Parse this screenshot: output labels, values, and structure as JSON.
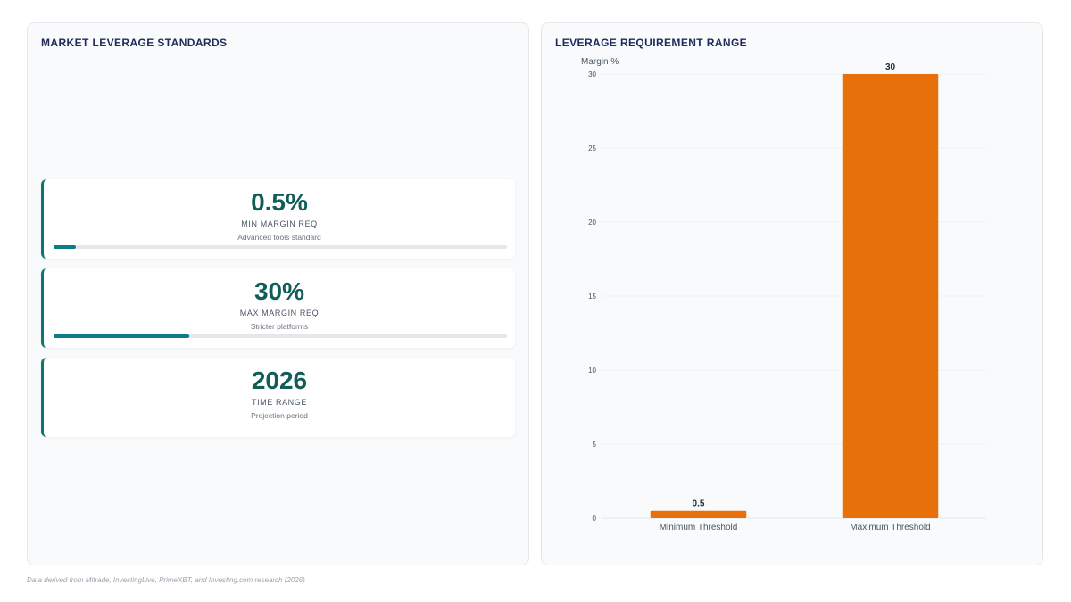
{
  "left_panel": {
    "title": "MARKET LEVERAGE STANDARDS",
    "stats": [
      {
        "value": "0.5%",
        "label": "MIN MARGIN REQ",
        "sub": "Advanced tools standard",
        "progress": 0.05
      },
      {
        "value": "30%",
        "label": "MAX MARGIN REQ",
        "sub": "Stricter platforms",
        "progress": 0.3
      },
      {
        "value": "2026",
        "label": "TIME RANGE",
        "sub": "Projection period"
      }
    ]
  },
  "right_panel": {
    "title": "LEVERAGE REQUIREMENT RANGE"
  },
  "chart_data": {
    "type": "bar",
    "categories": [
      "Minimum Threshold",
      "Maximum Threshold"
    ],
    "values": [
      0.5,
      30
    ],
    "data_labels": [
      "0.5",
      "30"
    ],
    "ylabel": "Margin %",
    "ylim": [
      0,
      30
    ],
    "yticks": [
      0,
      5,
      10,
      15,
      20,
      25,
      30
    ],
    "grid": true,
    "bar_color": "#e8700a",
    "legend": "none"
  },
  "footnote": "Data derived from Mitrade, InvestingLive, PrimeXBT, and Investing.com research (2026)",
  "colors": {
    "accent_teal": "#0f766e",
    "bar_orange": "#e8700a",
    "title_navy": "#1e2a5a"
  }
}
